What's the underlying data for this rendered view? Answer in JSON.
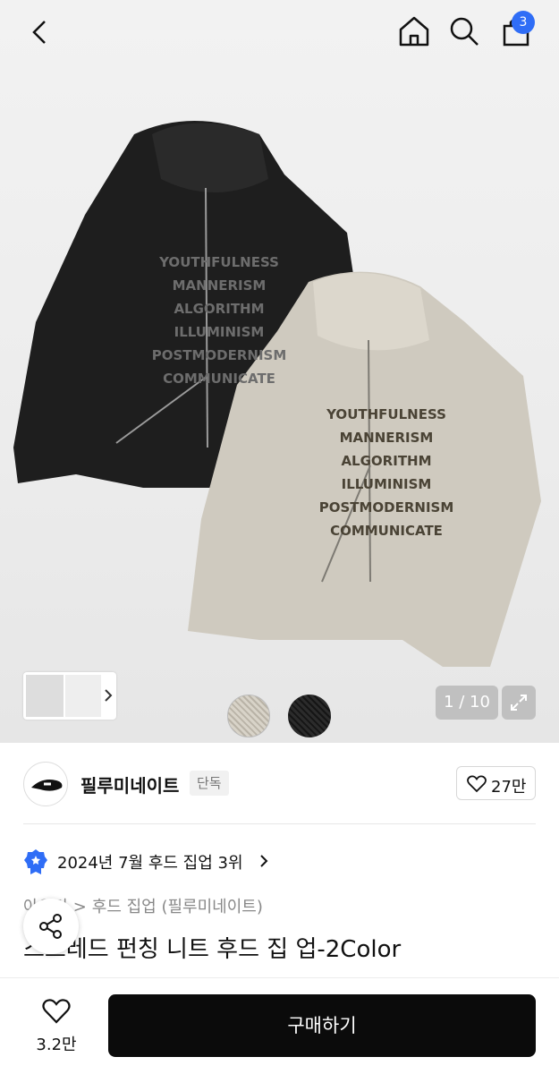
{
  "header": {
    "back_icon": "chevron-left-icon",
    "home_icon": "home-icon",
    "search_icon": "search-icon",
    "cart_icon": "shopping-bag-icon",
    "cart_count": "3",
    "badge_color": "#2f6df6"
  },
  "gallery": {
    "pager": "1 / 10",
    "expand_icon": "expand-icon",
    "garment_print": [
      "YOUTHFULNESS",
      "MANNERISM",
      "ALGORITHM",
      "ILLUMINISM",
      "POSTMODERNISM",
      "COMMUNICATE"
    ],
    "swatches": [
      "beige",
      "black"
    ]
  },
  "brand": {
    "name": "필루미네이트",
    "tag": "단독",
    "likes": "27만"
  },
  "ranking": {
    "text": "2024년 7월 후드 집업 3위"
  },
  "breadcrumb": {
    "parent": "아우터",
    "current": "후드 집업 (필루미네이트)"
  },
  "product": {
    "title": "스트레드 펀칭 니트 후드 집 업-2Color"
  },
  "bottom": {
    "likes": "3.2만",
    "buy_label": "구매하기"
  }
}
